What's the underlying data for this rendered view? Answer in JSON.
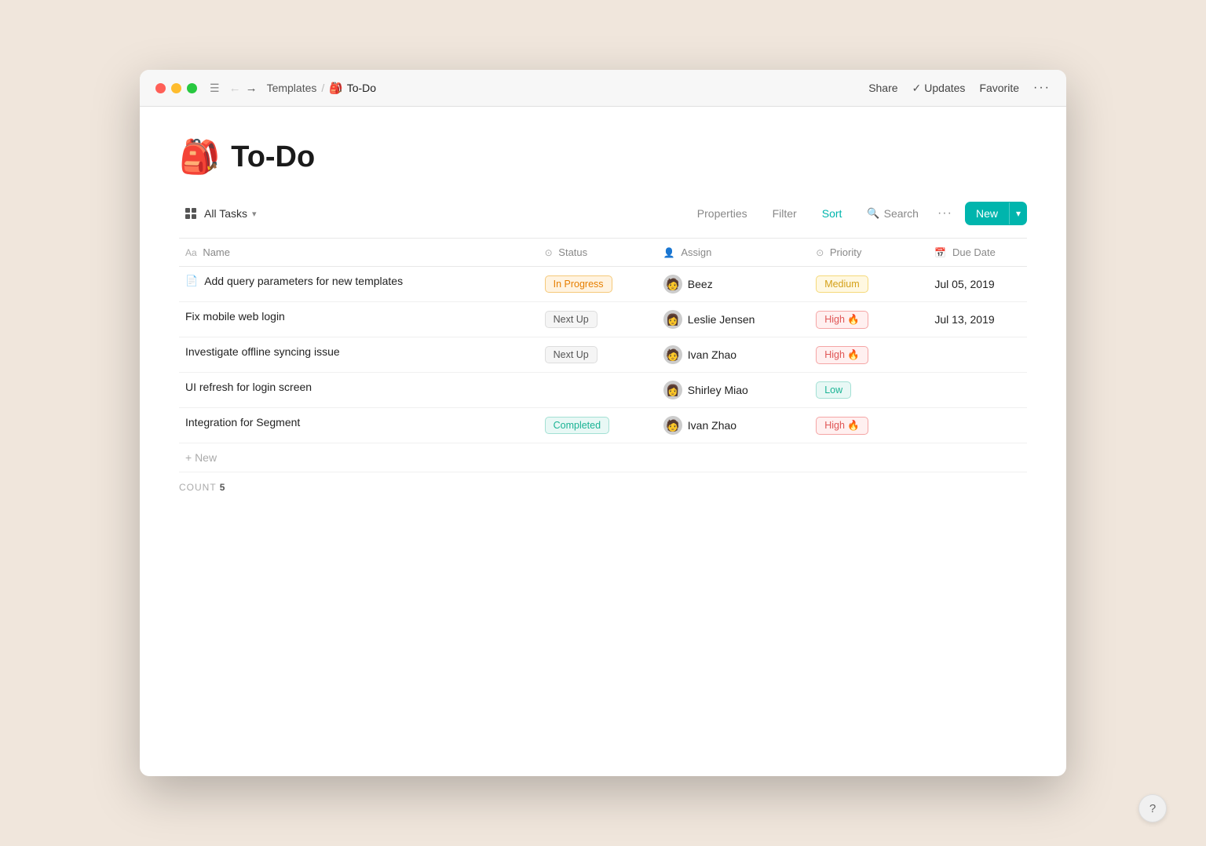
{
  "window": {
    "title": "To-Do"
  },
  "titlebar": {
    "breadcrumb_parent": "Templates",
    "breadcrumb_sep": "/",
    "breadcrumb_current": "To-Do",
    "breadcrumb_emoji": "🎒",
    "share_label": "Share",
    "updates_label": "Updates",
    "favorite_label": "Favorite",
    "more_label": "···"
  },
  "page": {
    "emoji": "🎒",
    "title": "To-Do"
  },
  "toolbar": {
    "view_label": "All Tasks",
    "properties_label": "Properties",
    "filter_label": "Filter",
    "sort_label": "Sort",
    "search_label": "Search",
    "new_label": "New"
  },
  "table": {
    "columns": [
      {
        "key": "name",
        "label": "Name",
        "icon": "text-icon"
      },
      {
        "key": "status",
        "label": "Status",
        "icon": "status-icon"
      },
      {
        "key": "assign",
        "label": "Assign",
        "icon": "person-icon"
      },
      {
        "key": "priority",
        "label": "Priority",
        "icon": "priority-icon"
      },
      {
        "key": "duedate",
        "label": "Due Date",
        "icon": "calendar-icon"
      }
    ],
    "rows": [
      {
        "name": "Add query parameters for new templates",
        "has_doc_icon": true,
        "status": "In Progress",
        "status_type": "in-progress",
        "assignee": "Beez",
        "assignee_emoji": "🧑",
        "priority": "Medium",
        "priority_type": "medium",
        "priority_emoji": "",
        "due_date": "Jul 05, 2019"
      },
      {
        "name": "Fix mobile web login",
        "has_doc_icon": false,
        "status": "Next Up",
        "status_type": "next-up",
        "assignee": "Leslie Jensen",
        "assignee_emoji": "👩",
        "priority": "High 🔥",
        "priority_type": "high",
        "priority_emoji": "🔥",
        "due_date": "Jul 13, 2019"
      },
      {
        "name": "Investigate offline syncing issue",
        "has_doc_icon": false,
        "status": "Next Up",
        "status_type": "next-up",
        "assignee": "Ivan Zhao",
        "assignee_emoji": "🧑",
        "priority": "High 🔥",
        "priority_type": "high",
        "priority_emoji": "🔥",
        "due_date": ""
      },
      {
        "name": "UI refresh for login screen",
        "has_doc_icon": false,
        "status": "",
        "status_type": "none",
        "assignee": "Shirley Miao",
        "assignee_emoji": "👩",
        "priority": "Low",
        "priority_type": "low",
        "priority_emoji": "",
        "due_date": ""
      },
      {
        "name": "Integration for Segment",
        "has_doc_icon": false,
        "status": "Completed",
        "status_type": "completed",
        "assignee": "Ivan Zhao",
        "assignee_emoji": "🧑",
        "priority": "High 🔥",
        "priority_type": "high",
        "priority_emoji": "🔥",
        "due_date": ""
      }
    ],
    "new_row_label": "+ New",
    "count_label": "COUNT",
    "count_value": "5"
  },
  "help": {
    "label": "?"
  }
}
